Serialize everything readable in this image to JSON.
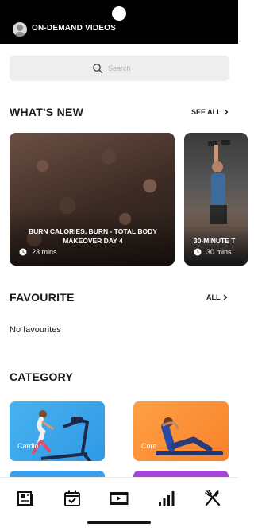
{
  "header": {
    "title": "ON-DEMAND VIDEOS",
    "avatar_icon": "user-avatar-icon",
    "background": "#000000"
  },
  "search": {
    "placeholder": "Search",
    "icon": "search-icon"
  },
  "whats_new": {
    "title": "WHAT'S NEW",
    "see_all_label": "SEE ALL",
    "cards": [
      {
        "title": "BURN CALORIES, BURN - TOTAL BODY MAKEOVER DAY 4",
        "duration": "23 mins"
      },
      {
        "title": "30-MINUTE T",
        "duration": "30 mins"
      }
    ]
  },
  "favourite": {
    "title": "FAVOURITE",
    "all_label": "ALL",
    "empty_text": "No favourites"
  },
  "category": {
    "title": "CATEGORY",
    "items": [
      {
        "label": "Cardio",
        "color": "#3aa6ef"
      },
      {
        "label": "Core",
        "color": "#f98e33"
      }
    ],
    "peek_colors": [
      "#3d9de8",
      "#a346d6"
    ]
  },
  "bottom_nav": {
    "items": [
      {
        "icon": "news-icon"
      },
      {
        "icon": "calendar-check-icon"
      },
      {
        "icon": "video-film-icon"
      },
      {
        "icon": "bar-chart-icon"
      },
      {
        "icon": "utensils-icon"
      }
    ]
  }
}
